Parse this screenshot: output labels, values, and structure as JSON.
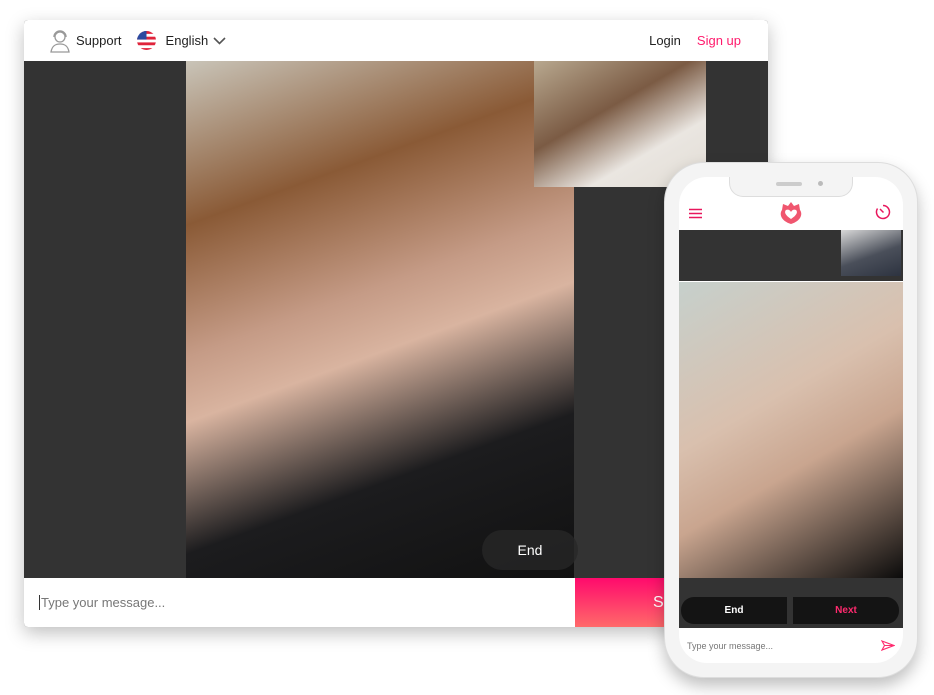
{
  "header": {
    "support": "Support",
    "language": "English",
    "login": "Login",
    "signup": "Sign up"
  },
  "desktop": {
    "end_button": "End",
    "message_placeholder": "Type your message...",
    "send_button": "Send"
  },
  "phone": {
    "end_button": "End",
    "next_button": "Next",
    "message_placeholder": "Type your message..."
  },
  "colors": {
    "accent": "#ff1a6c",
    "dark": "#333333"
  },
  "icons": {
    "support": "headset-person-icon",
    "flag": "us-flag-icon",
    "menu": "hamburger-icon",
    "logo": "heart-flame-logo",
    "timer": "timer-icon",
    "send": "paper-plane-icon"
  }
}
